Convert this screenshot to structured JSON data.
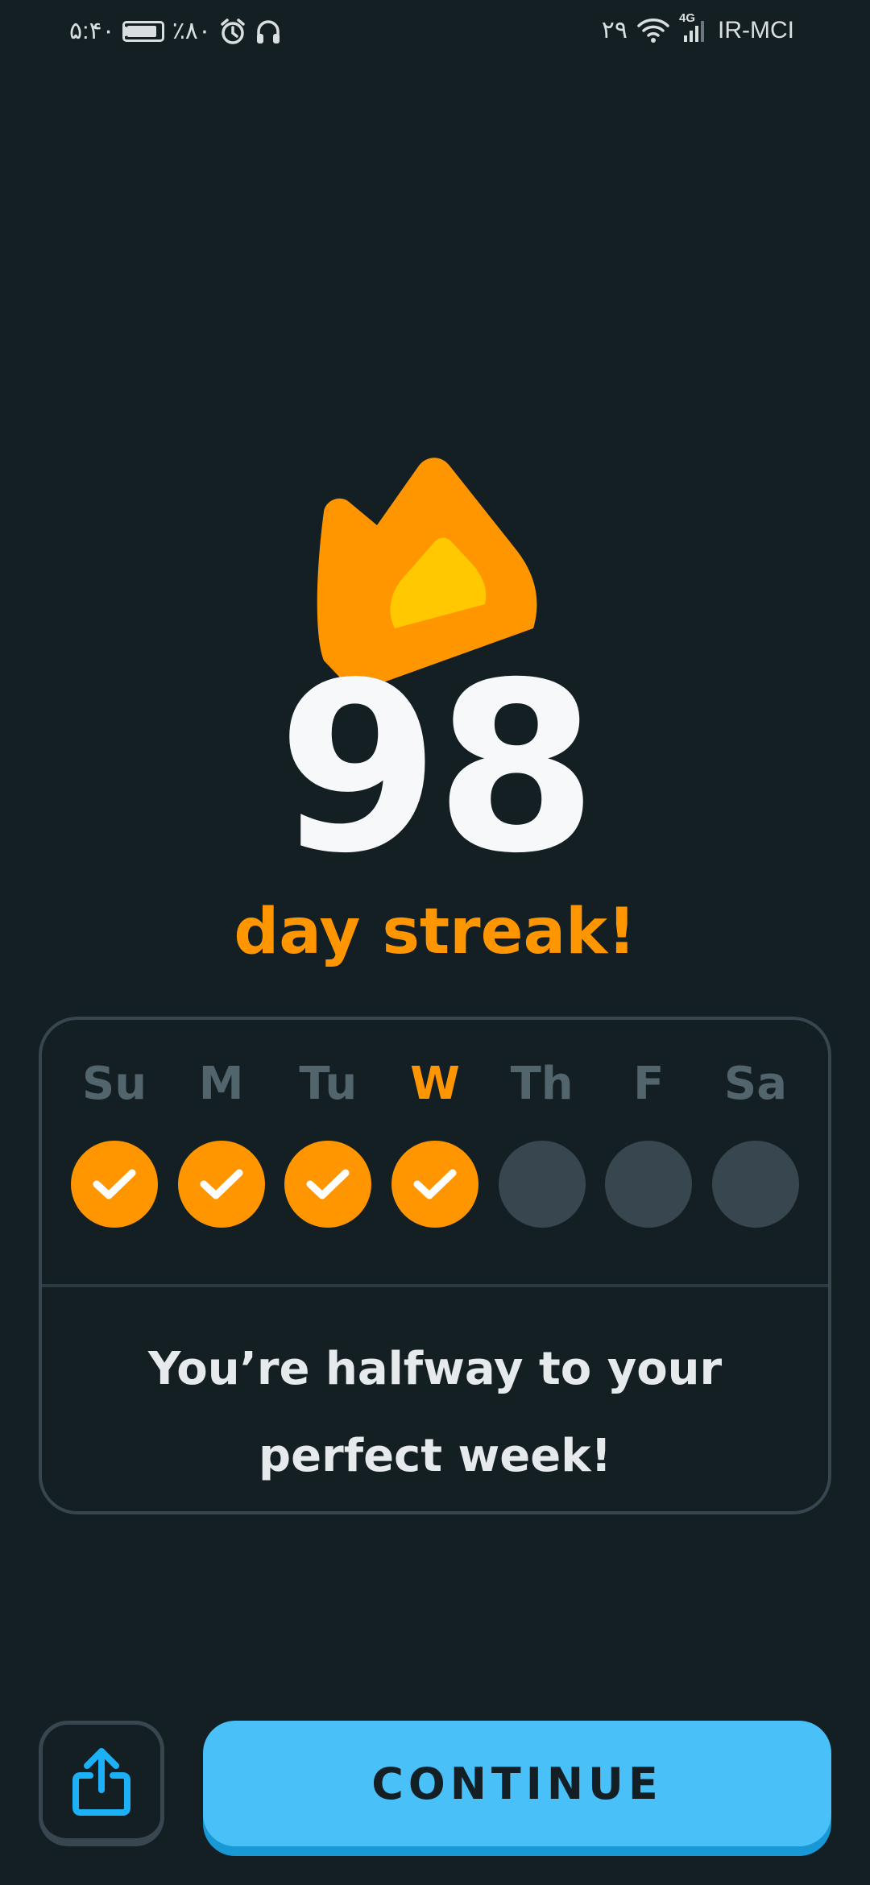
{
  "status_bar": {
    "time": "۵:۴۰",
    "battery_percent": "٪۸۰",
    "date": "۲۹",
    "network_type": "4G",
    "carrier": "IR-MCI",
    "icons": [
      "battery-icon",
      "alarm-icon",
      "headphones-icon",
      "wifi-icon",
      "signal-icon"
    ]
  },
  "streak": {
    "count": "98",
    "label": "day streak!",
    "icon": "flame-icon"
  },
  "week": {
    "days": [
      {
        "label": "Su",
        "done": true,
        "today": false
      },
      {
        "label": "M",
        "done": true,
        "today": false
      },
      {
        "label": "Tu",
        "done": true,
        "today": false
      },
      {
        "label": "W",
        "done": true,
        "today": true
      },
      {
        "label": "Th",
        "done": false,
        "today": false
      },
      {
        "label": "F",
        "done": false,
        "today": false
      },
      {
        "label": "Sa",
        "done": false,
        "today": false
      }
    ],
    "message": "You’re halfway to your perfect week!"
  },
  "actions": {
    "share_icon": "share-icon",
    "continue_label": "CONTINUE"
  },
  "colors": {
    "background": "#141f24",
    "accent_orange": "#ff9600",
    "flame_inner": "#ffc800",
    "inactive_circle": "#37464f",
    "button_blue": "#49c0f8",
    "button_blue_shadow": "#1899d6"
  }
}
